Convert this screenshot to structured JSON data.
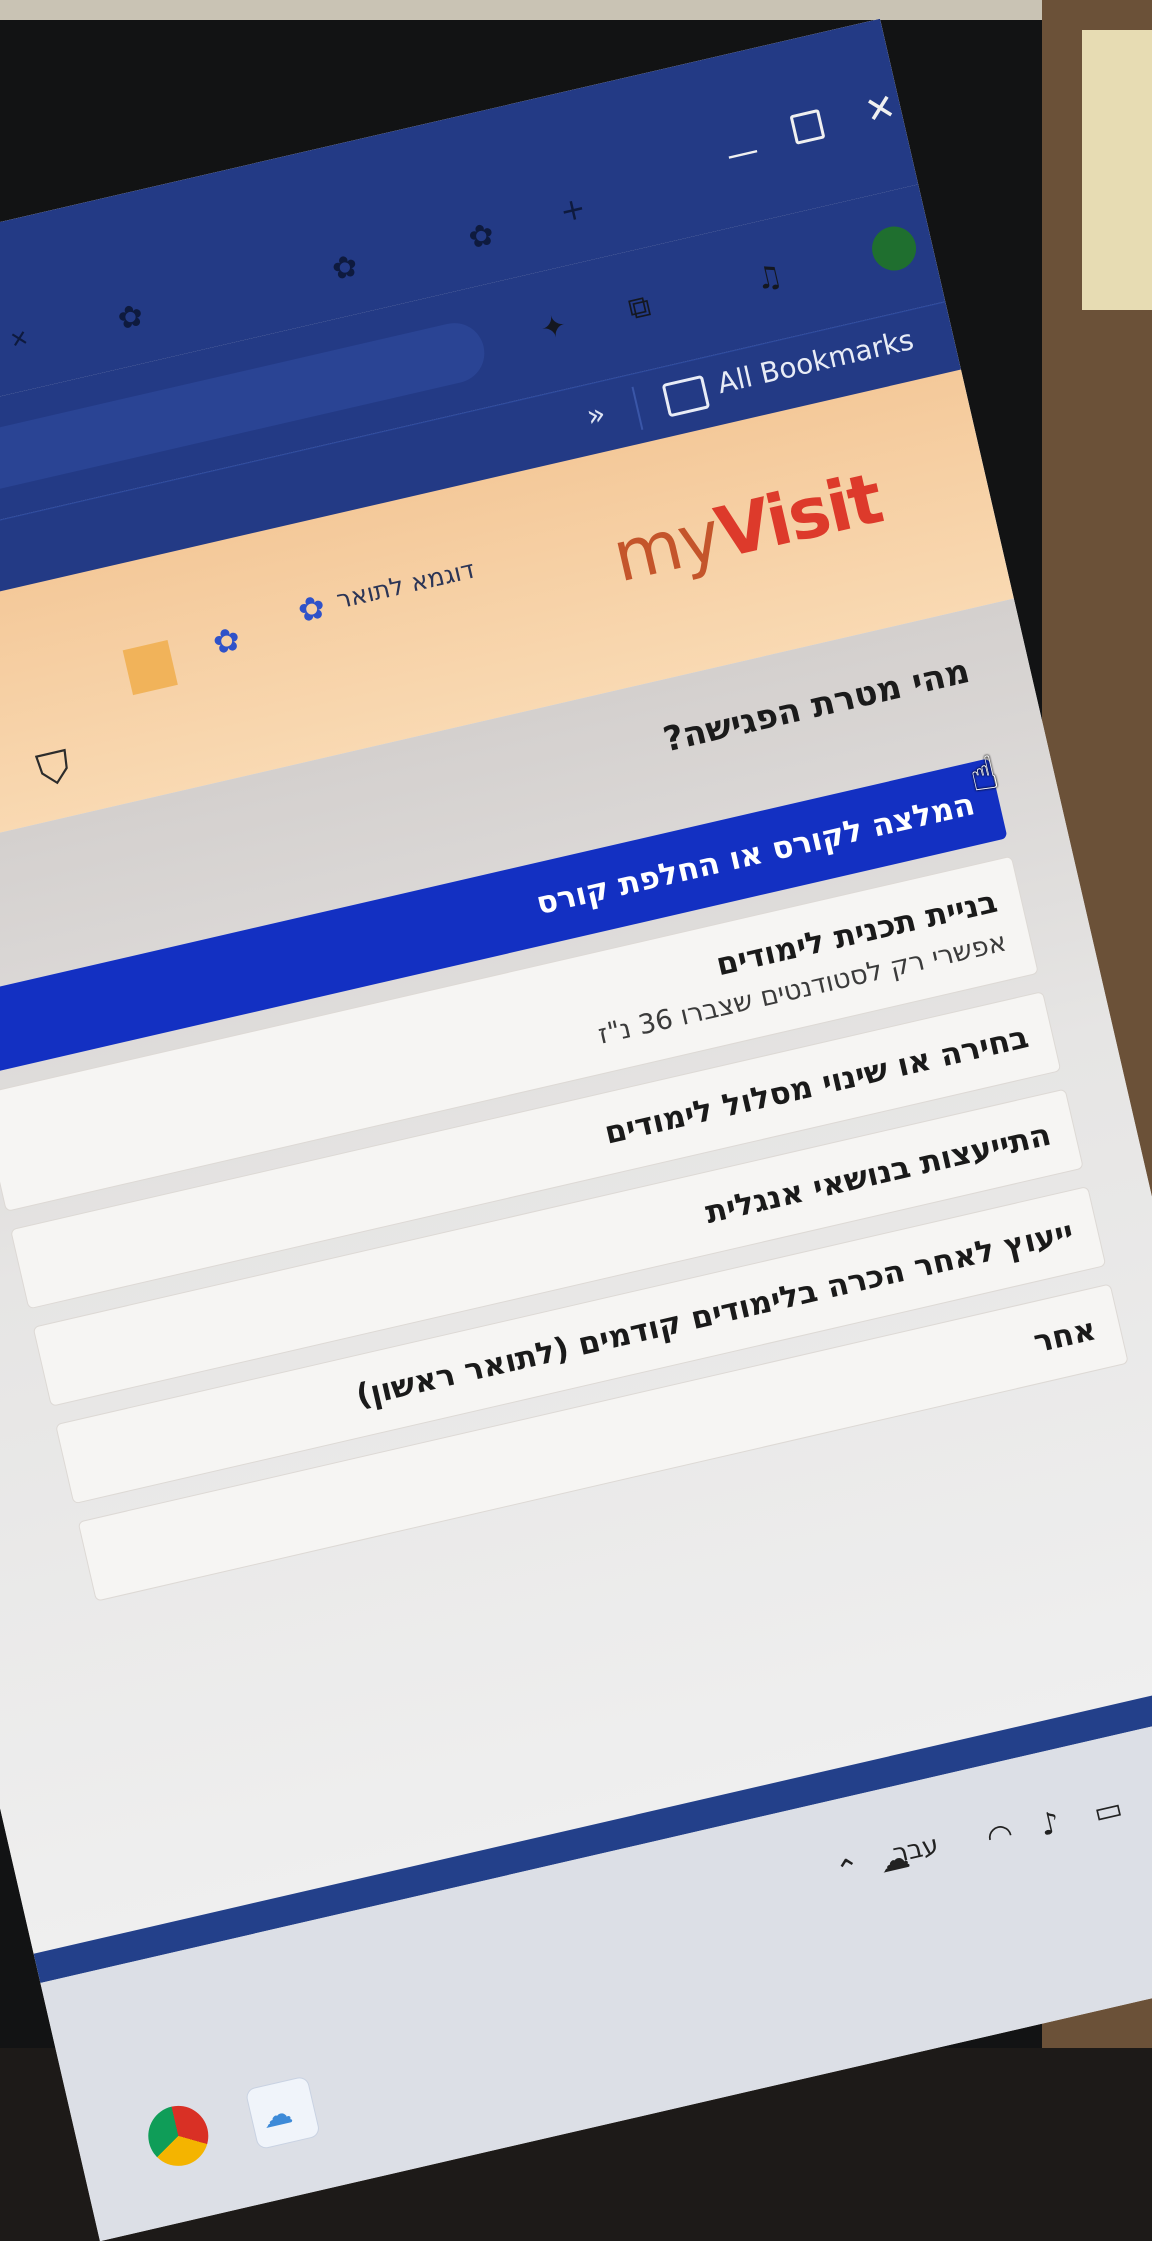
{
  "browser": {
    "tab_icons": [
      "app-icon",
      "app-icon",
      "app-icon"
    ],
    "address_text": "··· ··· ·········",
    "bookmarks_bar": {
      "overflow_label": "»",
      "all_bookmarks": "All Bookmarks"
    }
  },
  "site": {
    "logo_my": "my",
    "logo_visit": "Visit",
    "sample_link": "דוגמא לתואר",
    "colors": {
      "header_gradient": "#f4c99a",
      "logo_my": "#c4552b",
      "logo_visit": "#dd3a2b",
      "selected_option": "#1330c2",
      "browser_chrome": "#233a85"
    }
  },
  "form": {
    "question": "מהי מטרת הפגישה?",
    "options": [
      {
        "label": "המלצה לקורס או החלפת קורס",
        "sub": "",
        "selected": true
      },
      {
        "label": "בניית תכנית לימודים",
        "sub": "אפשרי רק לסטודנטים שצברו 36 נ\"ז",
        "selected": false
      },
      {
        "label": "בחירה או שינוי מסלול לימודים",
        "sub": "",
        "selected": false
      },
      {
        "label": "התייעצות בנושאי אנגלית",
        "sub": "",
        "selected": false
      },
      {
        "label": "ייעוץ לאחר הכרה בלימודים קודמים (לתואר ראשון)",
        "sub": "",
        "selected": false
      },
      {
        "label": "אחר",
        "sub": "",
        "selected": false
      }
    ]
  },
  "taskbar": {
    "language": "עבר",
    "tray_icons": [
      "chevron-up-icon",
      "onedrive-icon",
      "wifi-icon",
      "speaker-icon",
      "battery-icon"
    ],
    "pinned_apps": [
      "chrome-icon",
      "onedrive-icon"
    ]
  }
}
